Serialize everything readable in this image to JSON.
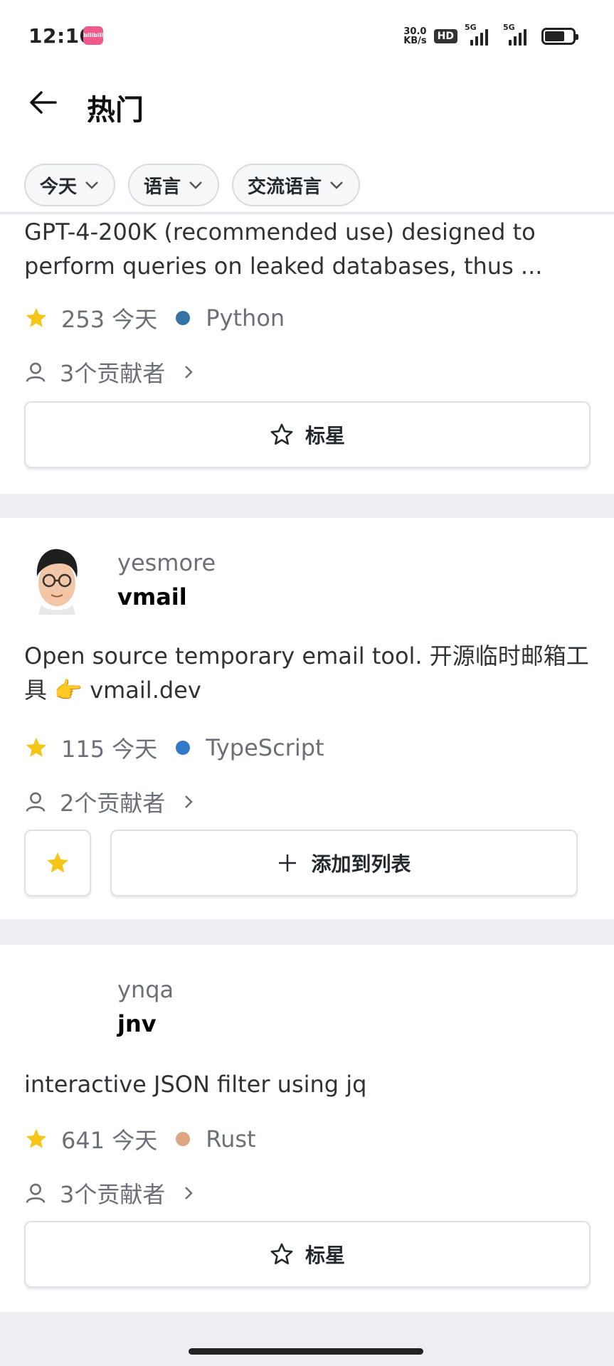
{
  "status_bar": {
    "time": "12:10",
    "app_badge": "bilibili",
    "net_speed_value": "30.0",
    "net_speed_unit": "KB/s",
    "hd_label": "HD",
    "network_1": "5G",
    "network_2": "5G",
    "battery_level": 0.7
  },
  "header": {
    "title": "热门",
    "filters": [
      {
        "label": "今天"
      },
      {
        "label": "语言"
      },
      {
        "label": "交流语言"
      }
    ]
  },
  "repos": [
    {
      "description": "GPT-4-200K (recommended use) designed to perform queries on leaked databases, thus ...",
      "stars_today": "253 今天",
      "language": "Python",
      "language_color": "#3572A5",
      "contributors": "3个贡献者",
      "star_button": "标星"
    },
    {
      "owner": "yesmore",
      "name": "vmail",
      "description": "Open source temporary email tool. 开源临时邮箱工具 👉 vmail.dev",
      "stars_today": "115 今天",
      "language": "TypeScript",
      "language_color": "#3178c6",
      "contributors": "2个贡献者",
      "add_to_list_button": "添加到列表",
      "starred": true
    },
    {
      "owner": "ynqa",
      "name": "jnv",
      "description": "interactive JSON filter using jq",
      "stars_today": "641 今天",
      "language": "Rust",
      "language_color": "#dea584",
      "contributors": "3个贡献者",
      "star_button": "标星"
    }
  ],
  "colors": {
    "star_yellow": "#f5c518",
    "page_bg": "#eceef2"
  }
}
